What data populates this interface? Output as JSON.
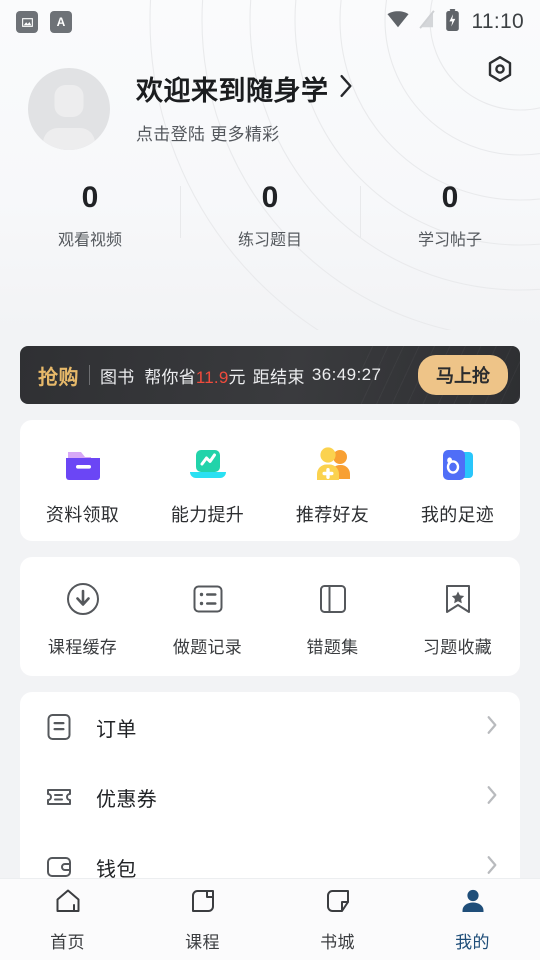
{
  "status_bar": {
    "icons": [
      "image-icon",
      "translate-icon"
    ],
    "wifi_icon": "wifi-icon",
    "signal_icon": "signal-off-icon",
    "battery_icon": "battery-charging-icon",
    "time": "11:10"
  },
  "header": {
    "settings_icon": "hex-settings-icon",
    "avatar": "default-avatar",
    "greeting": "欢迎来到随身学",
    "subtitle": "点击登陆 更多精彩",
    "chevron": "chevron-right-icon"
  },
  "stats": [
    {
      "value": "0",
      "label": "观看视频"
    },
    {
      "value": "0",
      "label": "练习题目"
    },
    {
      "value": "0",
      "label": "学习帖子"
    }
  ],
  "promo": {
    "tag": "抢购",
    "category": "图书",
    "save_prefix": "帮你省",
    "save_amount": "11.9",
    "save_suffix": "元",
    "countdown_label": "距结束",
    "countdown": "36:49:27",
    "button": "马上抢",
    "tag_color": "#e7b96a",
    "price_color": "#ef4b3c",
    "button_color": "#eec488"
  },
  "quick_actions": [
    {
      "label": "资料领取",
      "icon": "folder-icon",
      "color": "#6b46f5"
    },
    {
      "label": "能力提升",
      "icon": "laptop-chart-icon",
      "color": "#1fd6b5"
    },
    {
      "label": "推荐好友",
      "icon": "add-friends-icon",
      "color": "#f7c948"
    },
    {
      "label": "我的足迹",
      "icon": "footprint-card-icon",
      "color": "#4f6ef7"
    }
  ],
  "tools": [
    {
      "label": "课程缓存",
      "icon": "download-circle-icon"
    },
    {
      "label": "做题记录",
      "icon": "list-icon"
    },
    {
      "label": "错题集",
      "icon": "book-icon"
    },
    {
      "label": "习题收藏",
      "icon": "bookmark-star-icon"
    }
  ],
  "menu": [
    {
      "label": "订单",
      "icon": "order-icon",
      "chevron": "chevron-right-icon"
    },
    {
      "label": "优惠券",
      "icon": "coupon-icon",
      "chevron": "chevron-right-icon"
    },
    {
      "label": "钱包",
      "icon": "wallet-icon",
      "chevron": "chevron-right-icon"
    }
  ],
  "tabbar": {
    "active_color": "#1f4e79",
    "items": [
      {
        "label": "首页",
        "icon": "home-icon",
        "active": false
      },
      {
        "label": "课程",
        "icon": "course-icon",
        "active": false
      },
      {
        "label": "书城",
        "icon": "bookstore-icon",
        "active": false
      },
      {
        "label": "我的",
        "icon": "profile-icon",
        "active": true
      }
    ]
  }
}
